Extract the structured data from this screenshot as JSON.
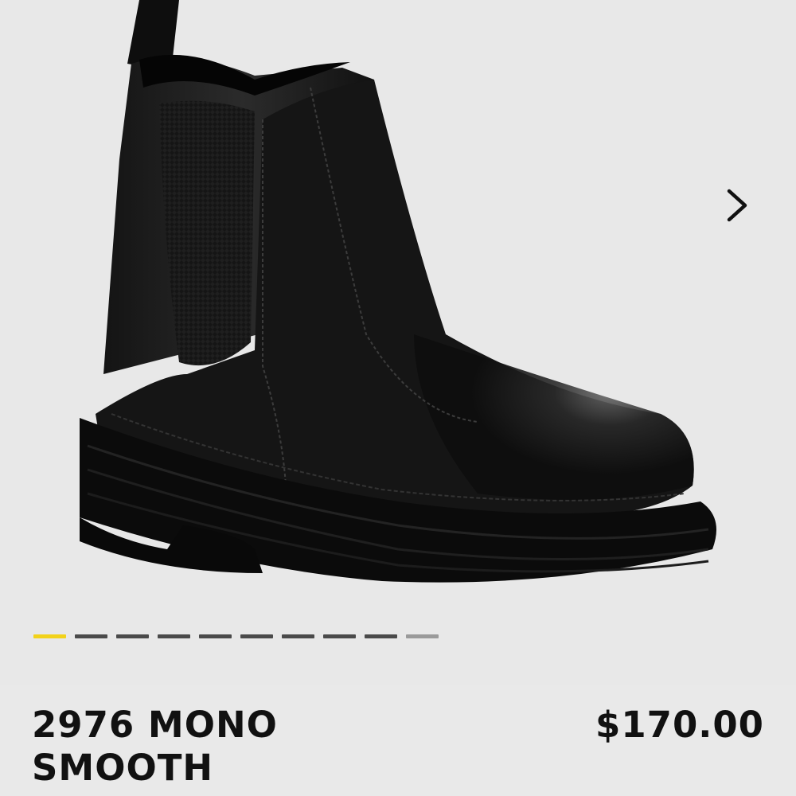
{
  "product": {
    "name": "2976 MONO SMOOTH",
    "name_line1": "2976 MONO",
    "name_line2": "SMOOTH",
    "price": "$170.00"
  },
  "gallery": {
    "image_subject": "black chelsea boot",
    "next_icon": "chevron-right-icon",
    "image_count": 10,
    "active_index": 0,
    "active_color": "#f2d21a",
    "inactive_color": "#4a4a4a"
  }
}
